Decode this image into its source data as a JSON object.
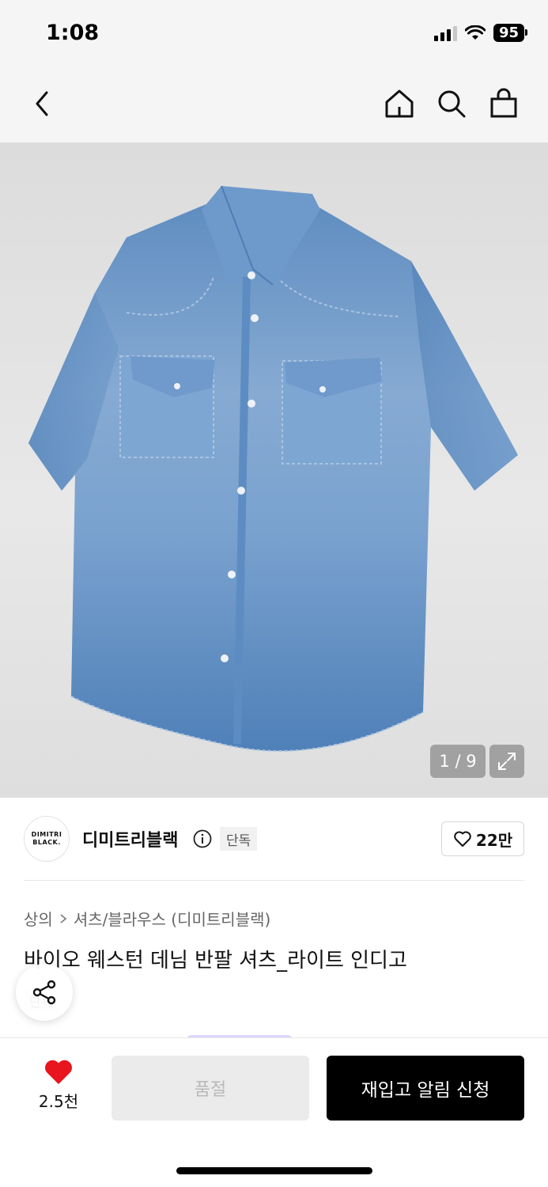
{
  "status_bar": {
    "time": "1:08",
    "battery": "95"
  },
  "nav": {
    "icons": [
      "back-arrow-icon",
      "home-icon",
      "search-icon",
      "shopping-bag-icon"
    ]
  },
  "gallery": {
    "counter": "1 / 9",
    "expand_icon": "expand-icon"
  },
  "brand": {
    "logo_line1": "DIMITRI",
    "logo_line2": "BLACK.",
    "name": "디미트리블랙",
    "exclusive": "단독",
    "likes": "22만"
  },
  "product": {
    "breadcrumb": [
      "상의",
      "셔츠/블라우스 (디미트리블랙)"
    ],
    "title": "바이오 웨스턴 데님 반팔 셔츠_라이트 인디고",
    "tags": [
      "단독"
    ]
  },
  "bottom_bar": {
    "wish_count": "2.5천",
    "soldout_label": "품절",
    "restock_label": "재입고 알림 신청"
  },
  "colors": {
    "heart": "#e8141e",
    "primary_button": "#000000",
    "disabled_button": "#ebebeb"
  }
}
